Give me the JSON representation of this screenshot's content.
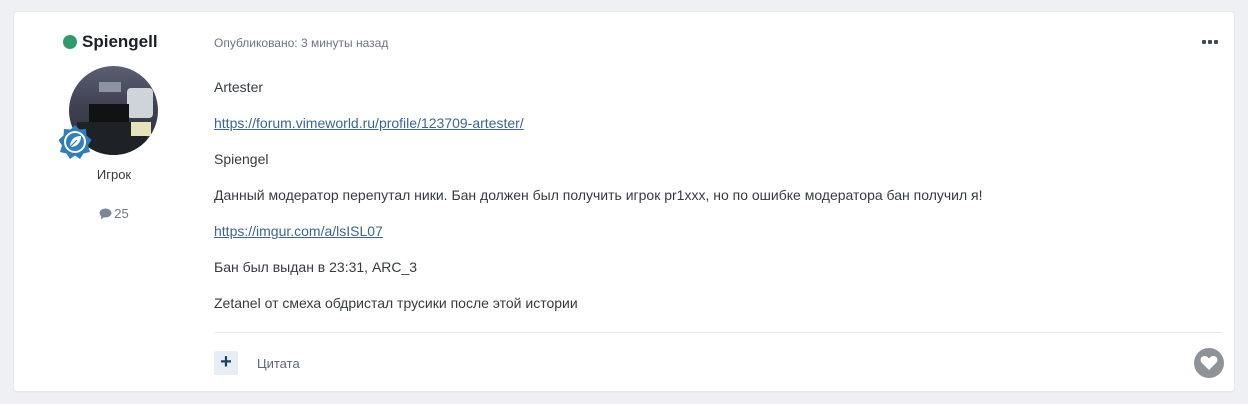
{
  "author": {
    "name": "Spiengell",
    "rank": "Игрок",
    "post_count": "25",
    "online_color": "#2e9a6e"
  },
  "post": {
    "meta": "Опубликовано: 3 минуты назад",
    "paragraphs": {
      "p1": "Artester",
      "p2": "https://forum.vimeworld.ru/profile/123709-artester/",
      "p3": "Spiengel",
      "p4": "Данный модератор перепутал ники. Бан должен был получить игрок pr1xxx, но по ошибке модератора бан получил я!",
      "p5": "https://imgur.com/a/lsISL07",
      "p6": "Бан был выдан в 23:31, ARC_3",
      "p7": "Zetanel от смеха обдристал трусики после этой истории"
    }
  },
  "footer": {
    "plus_label": "+",
    "quote_label": "Цитата"
  },
  "icons": {
    "more": "more-dots-icon",
    "heart": "heart-icon",
    "comment": "comment-bubble-icon",
    "badge": "leaf-badge-icon"
  }
}
